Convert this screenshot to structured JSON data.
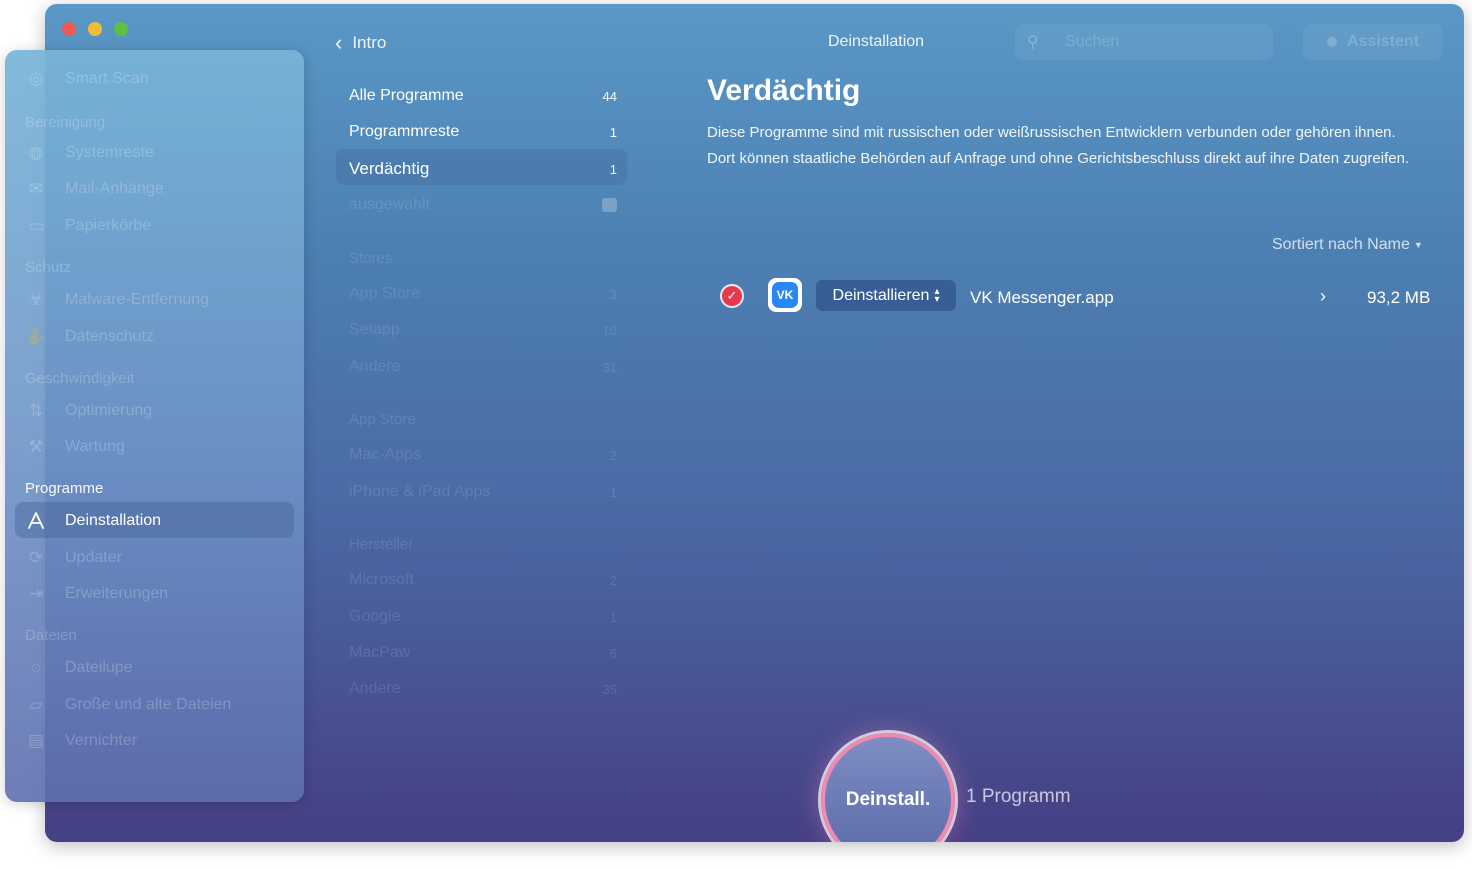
{
  "window": {
    "title": "Deinstallation",
    "back_label": "Intro",
    "search_placeholder": "Suchen",
    "assistant_label": "Assistent"
  },
  "sidebar": {
    "top_item": "Smart Scan",
    "sections": [
      {
        "title": "Bereinigung",
        "items": [
          {
            "label": "Systemreste",
            "icon": "systemreste-icon"
          },
          {
            "label": "Mail-Anhänge",
            "icon": "mail-icon"
          },
          {
            "label": "Papierkörbe",
            "icon": "trash-icon"
          }
        ]
      },
      {
        "title": "Schutz",
        "items": [
          {
            "label": "Malware-Entfernung",
            "icon": "biohazard-icon"
          },
          {
            "label": "Datenschutz",
            "icon": "hand-icon"
          }
        ]
      },
      {
        "title": "Geschwindigkeit",
        "items": [
          {
            "label": "Optimierung",
            "icon": "sliders-icon"
          },
          {
            "label": "Wartung",
            "icon": "wrench-icon"
          }
        ]
      },
      {
        "title": "Programme",
        "items": [
          {
            "label": "Deinstallation",
            "icon": "appstore-icon",
            "active": true
          },
          {
            "label": "Updater",
            "icon": "update-icon"
          },
          {
            "label": "Erweiterungen",
            "icon": "extensions-icon"
          }
        ]
      },
      {
        "title": "Dateien",
        "items": [
          {
            "label": "Dateilupe",
            "icon": "lens-icon"
          },
          {
            "label": "Große und alte Dateien",
            "icon": "folder-icon"
          },
          {
            "label": "Vernichter",
            "icon": "shredder-icon"
          }
        ]
      }
    ]
  },
  "categories": {
    "main": [
      {
        "label": "Alle Programme",
        "count": "44"
      },
      {
        "label": "Programmreste",
        "count": "1"
      },
      {
        "label": "Verdächtig",
        "count": "1",
        "active": true
      },
      {
        "label": "ausgewählt",
        "count": "1"
      }
    ],
    "groups": [
      {
        "title": "Stores",
        "items": [
          {
            "label": "App Store",
            "count": "3"
          },
          {
            "label": "Setapp",
            "count": "10"
          },
          {
            "label": "Andere",
            "count": "31"
          }
        ]
      },
      {
        "title": "App Store",
        "items": [
          {
            "label": "Mac-Apps",
            "count": "2"
          },
          {
            "label": "iPhone & iPad Apps",
            "count": "1"
          }
        ]
      },
      {
        "title": "Hersteller",
        "items": [
          {
            "label": "Microsoft",
            "count": "2"
          },
          {
            "label": "Google",
            "count": "1"
          },
          {
            "label": "MacPaw",
            "count": "6"
          },
          {
            "label": "Andere",
            "count": "35"
          }
        ]
      }
    ]
  },
  "main": {
    "heading": "Verdächtig",
    "description": "Diese Programme sind mit russischen oder weißrussischen Entwicklern verbunden oder gehören ihnen. Dort können staatliche Behörden auf Anfrage und ohne Gerichtsbeschluss direkt auf ihre Daten zugreifen.",
    "sort_label": "Sortiert nach Name",
    "apps": [
      {
        "action": "Deinstallieren",
        "name": "VK Messenger.app",
        "size": "93,2 MB",
        "checked": true,
        "icon_text": "VK"
      }
    ]
  },
  "footer": {
    "button_label": "Deinstall.",
    "count_label": "1 Programm"
  },
  "colors": {
    "check_red": "#e8394a",
    "ring_pink": "#f08ab0",
    "vk_blue": "#2787f5"
  }
}
